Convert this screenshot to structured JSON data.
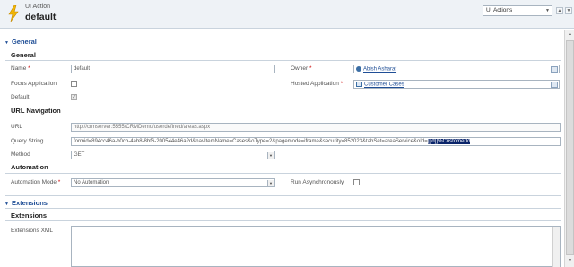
{
  "header": {
    "entity_type": "UI Action",
    "record_name": "default",
    "form_selector": "UI Actions"
  },
  "general_tab": {
    "title": "General",
    "general_section": {
      "title": "General",
      "name_label": "Name",
      "name_value": "default",
      "focus_label": "Focus Application",
      "focus_checked": false,
      "default_label": "Default",
      "default_checked": true,
      "owner_label": "Owner",
      "owner_value": "Abish Asharaf",
      "hosted_label": "Hosted Application",
      "hosted_value": "Customer Cases"
    },
    "url_section": {
      "title": "URL Navigation",
      "url_label": "URL",
      "url_value": "http://crmserver:5555/CRMDemo/userdefined/areas.aspx",
      "qs_label": "Query String",
      "qs_value": "formid=894cc46a-b0cb-4ab8-8bf6-200544e46a2d&navItemName=Cases&oType=2&pagemode=iframe&security=852023&tabSet=areaService&oId=",
      "qs_selected": "[[id]]%CustomerId",
      "method_label": "Method",
      "method_value": "GET"
    },
    "automation_section": {
      "title": "Automation",
      "mode_label": "Automation Mode",
      "mode_value": "No Automation",
      "async_label": "Run Asynchronously",
      "async_checked": false
    }
  },
  "extensions_tab": {
    "title": "Extensions",
    "section_title": "Extensions",
    "xml_label": "Extensions XML",
    "xml_value": ""
  }
}
